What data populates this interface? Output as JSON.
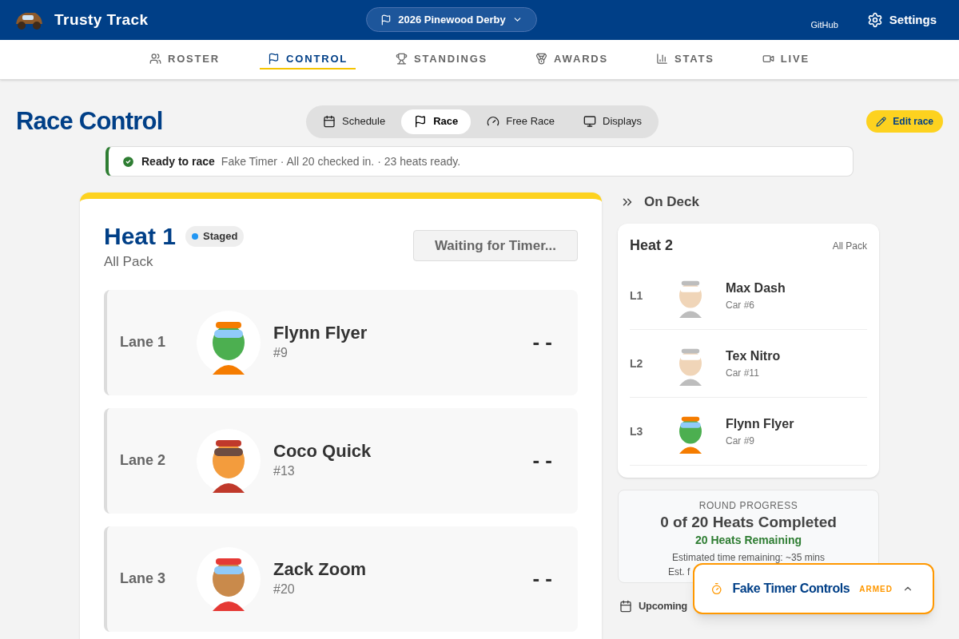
{
  "app": {
    "title": "Trusty Track",
    "event": "2026 Pinewood Derby",
    "links": [
      "GitHub"
    ],
    "settings": "Settings"
  },
  "nav": [
    {
      "label": "ROSTER",
      "selected": false
    },
    {
      "label": "CONTROL",
      "selected": true
    },
    {
      "label": "STANDINGS",
      "selected": false
    },
    {
      "label": "AWARDS",
      "selected": false
    },
    {
      "label": "STATS",
      "selected": false
    },
    {
      "label": "LIVE",
      "selected": false
    }
  ],
  "page": {
    "title": "Race Control",
    "edit_button": "Edit race"
  },
  "modes": [
    {
      "label": "Schedule",
      "selected": false
    },
    {
      "label": "Race",
      "selected": true
    },
    {
      "label": "Free Race",
      "selected": false
    },
    {
      "label": "Displays",
      "selected": false
    }
  ],
  "status": {
    "title": "Ready to race",
    "detail": "Fake Timer · All 20 checked in. · 23 heats ready."
  },
  "heat": {
    "title": "Heat 1",
    "badge": "Staged",
    "group": "All Pack",
    "action": "Waiting for Timer...",
    "lanes": [
      {
        "lane": "Lane 1",
        "name": "Flynn Flyer",
        "car": "#9",
        "time": "- -"
      },
      {
        "lane": "Lane 2",
        "name": "Coco Quick",
        "car": "#13",
        "time": "- -"
      },
      {
        "lane": "Lane 3",
        "name": "Zack Zoom",
        "car": "#20",
        "time": "- -"
      }
    ]
  },
  "on_deck": {
    "title": "On Deck",
    "heat": "Heat 2",
    "group": "All Pack",
    "lanes": [
      {
        "lane": "L1",
        "name": "Max Dash",
        "car": "Car #6"
      },
      {
        "lane": "L2",
        "name": "Tex Nitro",
        "car": "Car #11"
      },
      {
        "lane": "L3",
        "name": "Flynn Flyer",
        "car": "Car #9"
      }
    ]
  },
  "progress": {
    "label": "ROUND PROGRESS",
    "completed": "0 of 20 Heats Completed",
    "remaining": "20 Heats Remaining",
    "estimate": "Estimated time remaining: ~35 mins",
    "finish": "Est. f"
  },
  "upcoming": {
    "title": "Upcoming"
  },
  "timer_panel": {
    "title": "Fake Timer Controls",
    "state": "ARMED",
    "expanded": false
  }
}
